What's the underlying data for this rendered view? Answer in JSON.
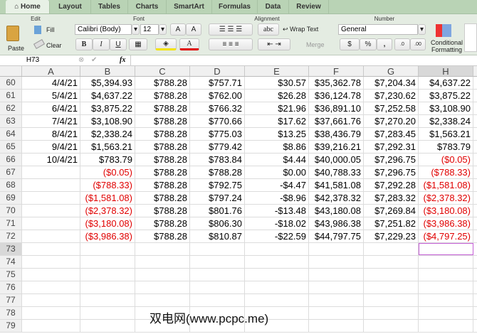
{
  "tabs": [
    "Home",
    "Layout",
    "Tables",
    "Charts",
    "SmartArt",
    "Formulas",
    "Data",
    "Review"
  ],
  "ribbon": {
    "edit_group": "Edit",
    "font_group": "Font",
    "alignment_group": "Alignment",
    "number_group": "Number",
    "paste": "Paste",
    "fill": "Fill",
    "clear": "Clear",
    "font_name": "Calibri (Body)",
    "font_size": "12",
    "bold": "B",
    "italic": "I",
    "underline": "U",
    "font_color": "A",
    "abc": "abc",
    "wrap_text": "Wrap Text",
    "merge": "Merge",
    "number_format": "General",
    "percent": "%",
    "comma": ",",
    "conditional": "Conditional",
    "formatting": "Formatting",
    "grow": "A",
    "shrink": "A"
  },
  "formula_bar": {
    "name_box": "H73",
    "fx": "fx",
    "value": ""
  },
  "columns": [
    "A",
    "B",
    "C",
    "D",
    "E",
    "F",
    "G",
    "H"
  ],
  "rows": [
    {
      "n": "60",
      "cells": [
        "4/4/21",
        "$5,394.93",
        "$788.28",
        "$757.71",
        "$30.57",
        "$35,362.78",
        "$7,204.34",
        "$4,637.22"
      ]
    },
    {
      "n": "61",
      "cells": [
        "5/4/21",
        "$4,637.22",
        "$788.28",
        "$762.00",
        "$26.28",
        "$36,124.78",
        "$7,230.62",
        "$3,875.22"
      ]
    },
    {
      "n": "62",
      "cells": [
        "6/4/21",
        "$3,875.22",
        "$788.28",
        "$766.32",
        "$21.96",
        "$36,891.10",
        "$7,252.58",
        "$3,108.90"
      ]
    },
    {
      "n": "63",
      "cells": [
        "7/4/21",
        "$3,108.90",
        "$788.28",
        "$770.66",
        "$17.62",
        "$37,661.76",
        "$7,270.20",
        "$2,338.24"
      ]
    },
    {
      "n": "64",
      "cells": [
        "8/4/21",
        "$2,338.24",
        "$788.28",
        "$775.03",
        "$13.25",
        "$38,436.79",
        "$7,283.45",
        "$1,563.21"
      ]
    },
    {
      "n": "65",
      "cells": [
        "9/4/21",
        "$1,563.21",
        "$788.28",
        "$779.42",
        "$8.86",
        "$39,216.21",
        "$7,292.31",
        "$783.79"
      ]
    },
    {
      "n": "66",
      "cells": [
        "10/4/21",
        "$783.79",
        "$788.28",
        "$783.84",
        "$4.44",
        "$40,000.05",
        "$7,296.75",
        "($0.05)"
      ]
    },
    {
      "n": "67",
      "cells": [
        "",
        "($0.05)",
        "$788.28",
        "$788.28",
        "$0.00",
        "$40,788.33",
        "$7,296.75",
        "($788.33)"
      ]
    },
    {
      "n": "68",
      "cells": [
        "",
        "($788.33)",
        "$788.28",
        "$792.75",
        "-$4.47",
        "$41,581.08",
        "$7,292.28",
        "($1,581.08)"
      ]
    },
    {
      "n": "69",
      "cells": [
        "",
        "($1,581.08)",
        "$788.28",
        "$797.24",
        "-$8.96",
        "$42,378.32",
        "$7,283.32",
        "($2,378.32)"
      ]
    },
    {
      "n": "70",
      "cells": [
        "",
        "($2,378.32)",
        "$788.28",
        "$801.76",
        "-$13.48",
        "$43,180.08",
        "$7,269.84",
        "($3,180.08)"
      ]
    },
    {
      "n": "71",
      "cells": [
        "",
        "($3,180.08)",
        "$788.28",
        "$806.30",
        "-$18.02",
        "$43,986.38",
        "$7,251.82",
        "($3,986.38)"
      ]
    },
    {
      "n": "72",
      "cells": [
        "",
        "($3,986.38)",
        "$788.28",
        "$810.87",
        "-$22.59",
        "$44,797.75",
        "$7,229.23",
        "($4,797.25)"
      ]
    },
    {
      "n": "73",
      "cells": [
        "",
        "",
        "",
        "",
        "",
        "",
        "",
        ""
      ]
    },
    {
      "n": "74",
      "cells": [
        "",
        "",
        "",
        "",
        "",
        "",
        "",
        ""
      ]
    },
    {
      "n": "75",
      "cells": [
        "",
        "",
        "",
        "",
        "",
        "",
        "",
        ""
      ]
    },
    {
      "n": "76",
      "cells": [
        "",
        "",
        "",
        "",
        "",
        "",
        "",
        ""
      ]
    },
    {
      "n": "77",
      "cells": [
        "",
        "",
        "",
        "",
        "",
        "",
        "",
        ""
      ]
    },
    {
      "n": "78",
      "cells": [
        "",
        "",
        "",
        "",
        "",
        "",
        "",
        ""
      ]
    },
    {
      "n": "79",
      "cells": [
        "",
        "",
        "",
        "",
        "",
        "",
        "",
        ""
      ]
    }
  ],
  "watermark": "双电网(www.pcpc.me)"
}
